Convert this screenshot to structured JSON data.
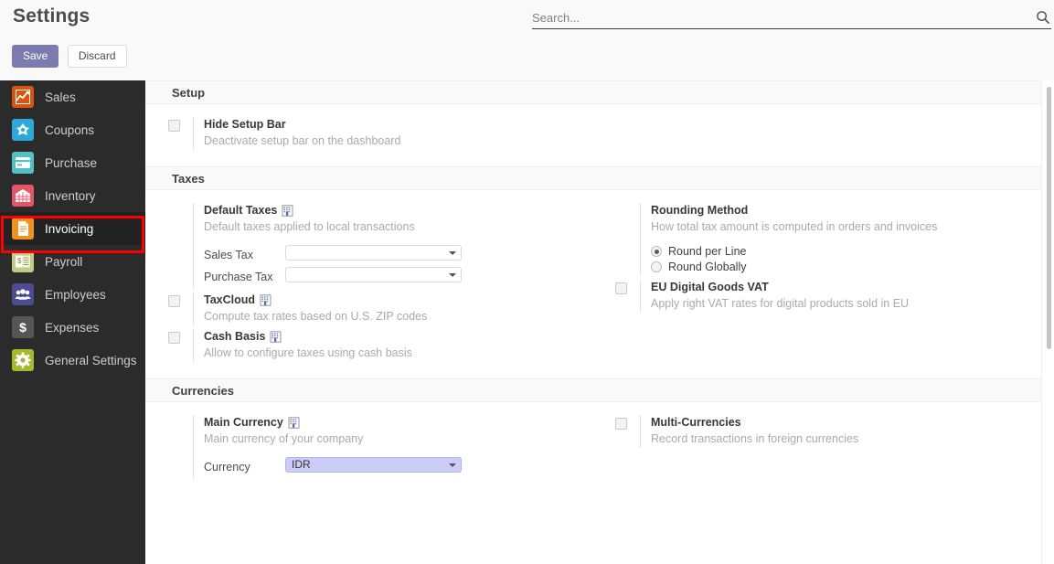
{
  "header": {
    "title": "Settings",
    "save_label": "Save",
    "discard_label": "Discard",
    "search_placeholder": "Search...",
    "search_value": "",
    "search_icon": "magnifier-icon",
    "accent_color": "#7c7bad"
  },
  "sidebar": {
    "background": "#2b2b2b",
    "highlight_color": "#ff0000",
    "items": [
      {
        "label": "Sales",
        "icon": "sales-chart-icon",
        "color": "#d9540d",
        "active": false
      },
      {
        "label": "Coupons",
        "icon": "coupon-tag-icon",
        "color": "#2ea8d8",
        "active": false
      },
      {
        "label": "Purchase",
        "icon": "credit-card-icon",
        "color": "#55c0c4",
        "active": false
      },
      {
        "label": "Inventory",
        "icon": "warehouse-icon",
        "color": "#e2566a",
        "active": false
      },
      {
        "label": "Invoicing",
        "icon": "invoice-document-icon",
        "color": "#f0921e",
        "active": true
      },
      {
        "label": "Payroll",
        "icon": "payslip-icon",
        "color": "#c3c987",
        "active": false
      },
      {
        "label": "Employees",
        "icon": "people-group-icon",
        "color": "#4b4b92",
        "active": false
      },
      {
        "label": "Expenses",
        "icon": "dollar-sign-icon",
        "color": "#555555",
        "active": false
      },
      {
        "label": "General Settings",
        "icon": "gear-icon",
        "color": "#a5b92c",
        "active": false
      }
    ]
  },
  "sections": [
    {
      "title": "Setup",
      "left": [
        {
          "kind": "checkbox",
          "checked": false,
          "title": "Hide Setup Bar",
          "company_icon": false,
          "description": "Deactivate setup bar on the dashboard"
        }
      ],
      "right": []
    },
    {
      "title": "Taxes",
      "left": [
        {
          "kind": "plain",
          "title": "Default Taxes",
          "company_icon": true,
          "description": "Default taxes applied to local transactions",
          "fields": [
            {
              "label": "Sales Tax",
              "value": "",
              "highlight": false
            },
            {
              "label": "Purchase Tax",
              "value": "",
              "highlight": false
            }
          ]
        },
        {
          "kind": "checkbox",
          "checked": false,
          "title": "TaxCloud",
          "company_icon": true,
          "description": "Compute tax rates based on U.S. ZIP codes"
        },
        {
          "kind": "checkbox",
          "checked": false,
          "title": "Cash Basis",
          "company_icon": true,
          "description": "Allow to configure taxes using cash basis"
        }
      ],
      "right": [
        {
          "kind": "plain",
          "title": "Rounding Method",
          "company_icon": false,
          "description": "How total tax amount is computed in orders and invoices",
          "radios": [
            {
              "label": "Round per Line",
              "selected": true
            },
            {
              "label": "Round Globally",
              "selected": false
            }
          ]
        },
        {
          "kind": "checkbox",
          "checked": false,
          "title": "EU Digital Goods VAT",
          "company_icon": false,
          "description": "Apply right VAT rates for digital products sold in EU"
        }
      ]
    },
    {
      "title": "Currencies",
      "left": [
        {
          "kind": "plain",
          "title": "Main Currency",
          "company_icon": true,
          "description": "Main currency of your company",
          "fields": [
            {
              "label": "Currency",
              "value": "IDR",
              "highlight": true
            }
          ]
        }
      ],
      "right": [
        {
          "kind": "checkbox",
          "checked": false,
          "title": "Multi-Currencies",
          "company_icon": false,
          "description": "Record transactions in foreign currencies"
        }
      ]
    }
  ]
}
